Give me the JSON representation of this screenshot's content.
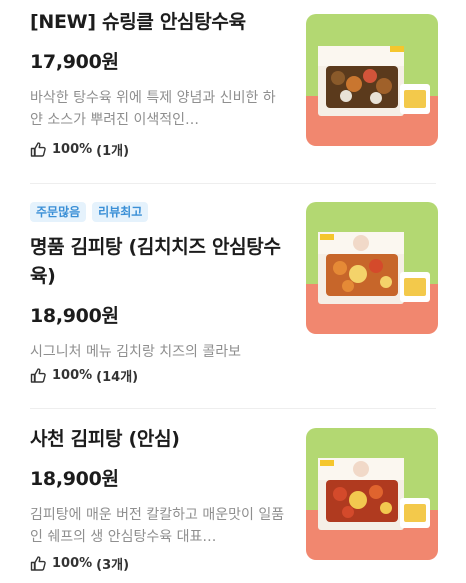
{
  "menu": {
    "items": [
      {
        "name": "[NEW] 슈링클 안심탕수육",
        "badges": [],
        "price": "17,900원",
        "description": "바삭한 탕수육 위에 특제 양념과 신비한 하얀 소스가 뿌려진 이색적인…",
        "rating": "100%",
        "review_count": "(1개)",
        "colors": {
          "sauce": "#d2543a",
          "topping": "#e8e2d6"
        }
      },
      {
        "name": "명품 김피탕 (김치치즈 안심탕수육)",
        "badges": [
          "주문많음",
          "리뷰최고"
        ],
        "price": "18,900원",
        "description": "시그니처 메뉴 김치랑 치즈의 콜라보",
        "rating": "100%",
        "review_count": "(14개)",
        "colors": {
          "sauce": "#e58a36",
          "topping": "#f4d36a"
        }
      },
      {
        "name": "사천 김피탕 (안심)",
        "badges": [],
        "price": "18,900원",
        "description": "김피탕에 매운 버전 칼칼하고 매운맛이 일품 인 쉐프의 생 안심탕수육 대표…",
        "rating": "100%",
        "review_count": "(3개)",
        "colors": {
          "sauce": "#d44a2b",
          "topping": "#f2c84f"
        }
      }
    ]
  },
  "theme": {
    "thumb_green": "#b3d872",
    "thumb_coral": "#f1876f",
    "badge_text": "#3a8fd6",
    "badge_bg": "#e5f2fc"
  },
  "icons": {
    "rating": "thumbs-up-icon"
  }
}
